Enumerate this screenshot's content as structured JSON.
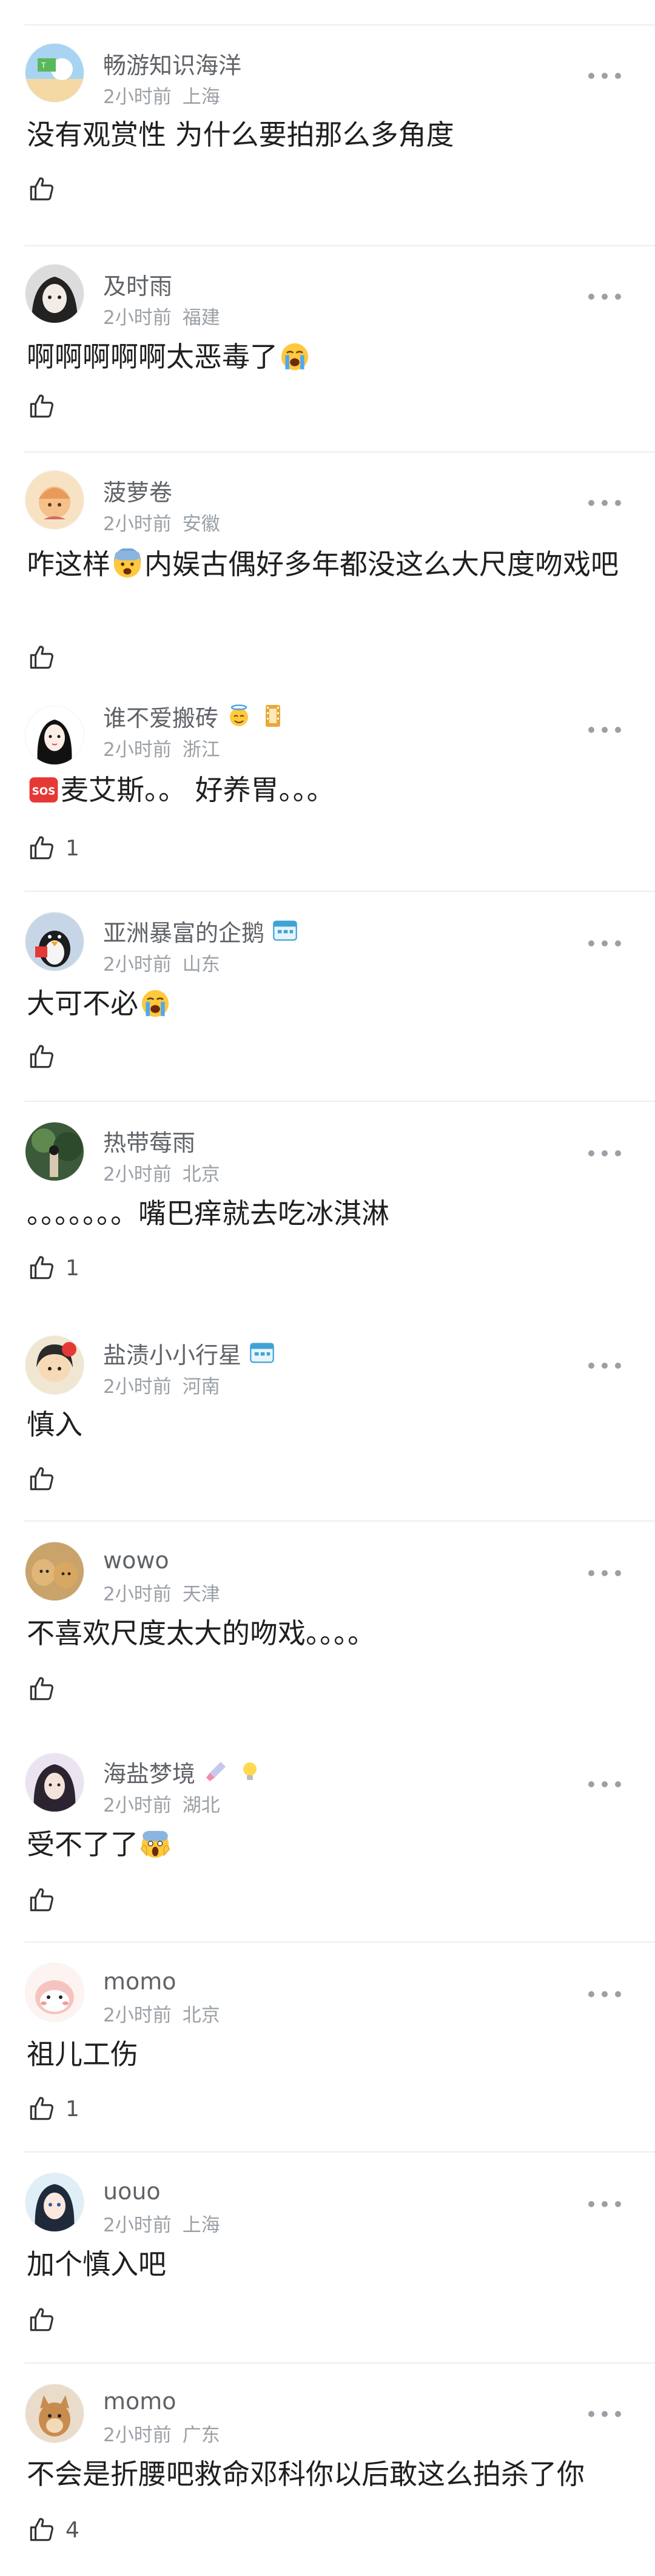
{
  "comments": [
    {
      "name": "畅游知识海洋",
      "time": "2小时前",
      "location": "上海",
      "text": "没有观赏性 为什么要拍那么多角度",
      "likes": ""
    },
    {
      "name": "及时雨",
      "time": "2小时前",
      "location": "福建",
      "text": "啊啊啊啊啊太恶毒了",
      "likes": ""
    },
    {
      "name": "菠萝卷",
      "time": "2小时前",
      "location": "安徽",
      "text_a": "咋这样",
      "text_b": "内娱古偶好多年都没这么大尺度吻戏吧",
      "likes": ""
    },
    {
      "name": "谁不爱搬砖",
      "time": "2小时前",
      "location": "浙江",
      "text": "麦艾斯。。 好养胃。。。",
      "likes": "1"
    },
    {
      "name": "亚洲暴富的企鹅",
      "time": "2小时前",
      "location": "山东",
      "text": "大可不必",
      "likes": ""
    },
    {
      "name": "热带莓雨",
      "time": "2小时前",
      "location": "北京",
      "text": "。。。。。。。嘴巴痒就去吃冰淇淋",
      "likes": "1"
    },
    {
      "name": "盐渍小小行星",
      "time": "2小时前",
      "location": "河南",
      "text": "慎入",
      "likes": ""
    },
    {
      "name": "wowo",
      "time": "2小时前",
      "location": "天津",
      "text": "不喜欢尺度太大的吻戏。。。。",
      "likes": ""
    },
    {
      "name": "海盐梦境",
      "time": "2小时前",
      "location": "湖北",
      "text": "受不了了",
      "likes": ""
    },
    {
      "name": "momo",
      "time": "2小时前",
      "location": "北京",
      "text": "祖儿工伤",
      "likes": "1"
    },
    {
      "name": "uouo",
      "time": "2小时前",
      "location": "上海",
      "text": "加个慎入吧",
      "likes": ""
    },
    {
      "name": "momo",
      "time": "2小时前",
      "location": "广东",
      "text": "不会是折腰吧救命邓科你以后敢这么拍杀了你",
      "likes": "4"
    }
  ],
  "icons": {
    "more": "more-dots-icon",
    "like": "thumbs-up-icon",
    "crying_emoji": "loudly-crying-face-icon",
    "fearful_emoji": "fearful-face-icon",
    "screaming_emoji": "screaming-face-icon",
    "sos_emoji": "sos-button-icon",
    "member_badge": "calendar-badge-icon",
    "angel_badge": "halo-face-icon"
  },
  "colors": {
    "name": "#5f6368",
    "meta": "#9aa0a6",
    "text": "#1f1f1f",
    "divider": "#eeeeee"
  }
}
